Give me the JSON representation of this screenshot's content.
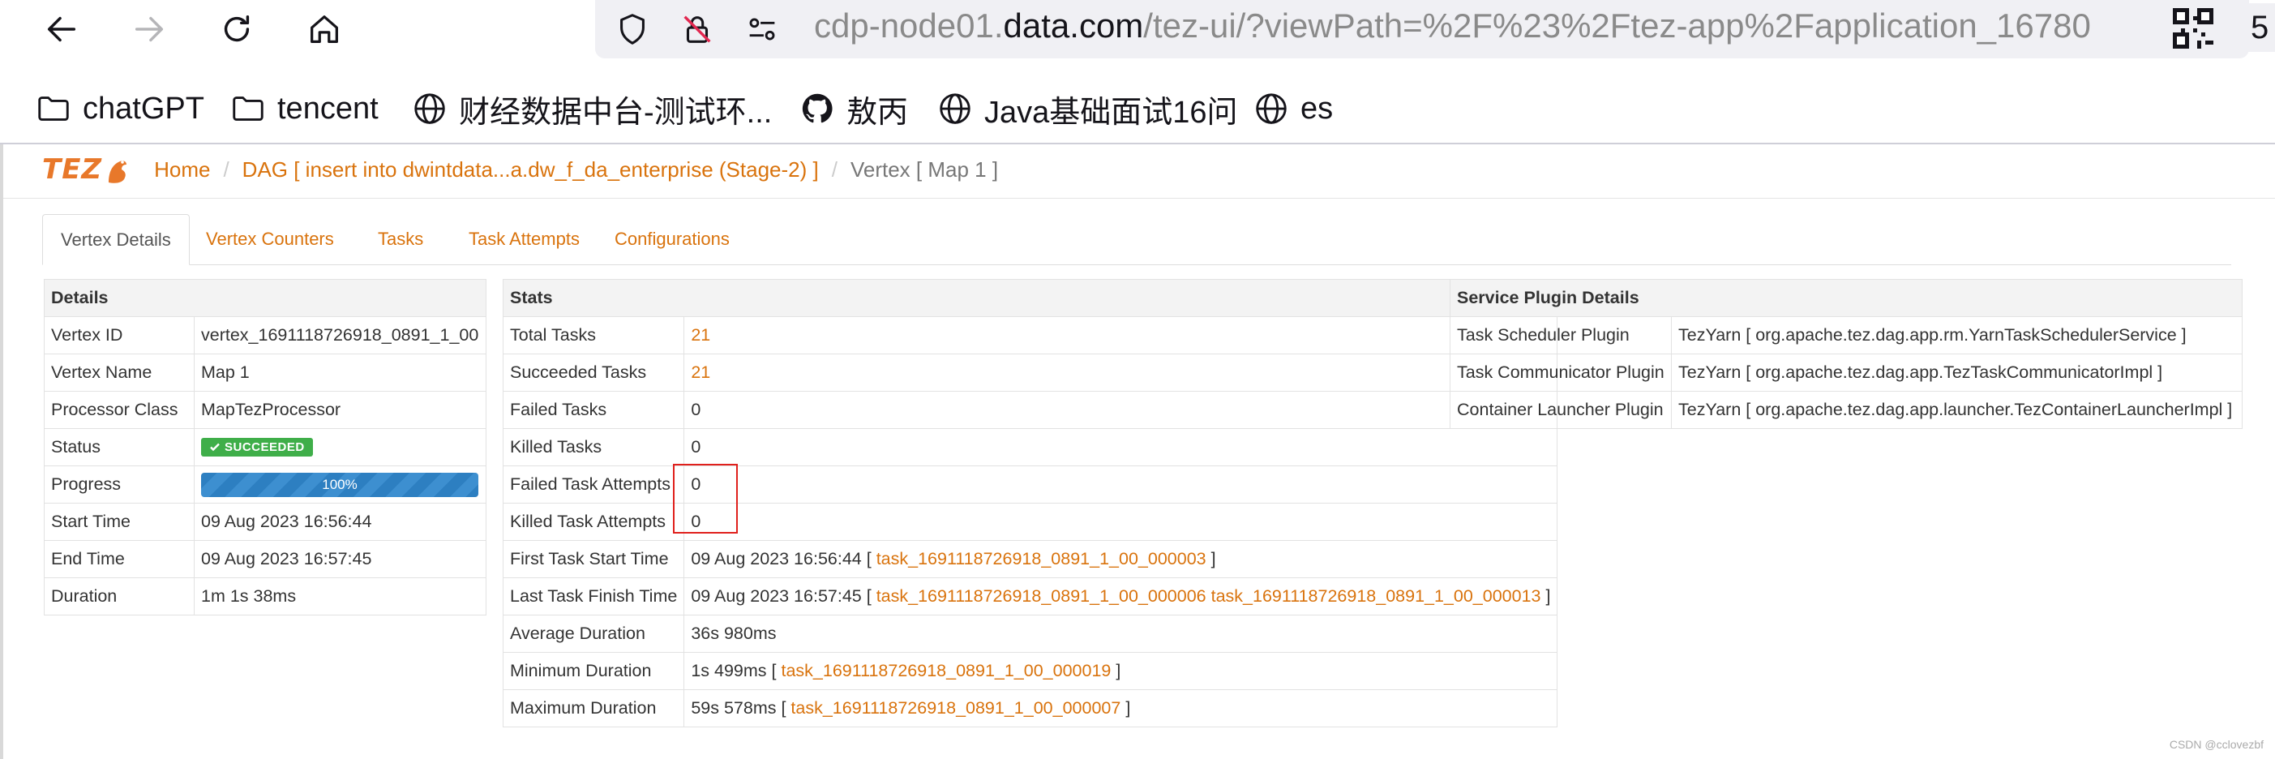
{
  "browser": {
    "url_prefix": "cdp-node01.",
    "url_host": "data.com",
    "url_rest": "/tez-ui/?viewPath=%2F%23%2Ftez-app%2Fapplication_16780",
    "extension_badge": "5"
  },
  "bookmarks": [
    {
      "label": "chatGPT",
      "icon": "folder-icon"
    },
    {
      "label": "tencent",
      "icon": "folder-icon"
    },
    {
      "label": "财经数据中台-测试环...",
      "icon": "globe-icon"
    },
    {
      "label": "敖丙",
      "icon": "github-icon"
    },
    {
      "label": "Java基础面试16问",
      "icon": "globe-icon"
    },
    {
      "label": "es",
      "icon": "globe-icon"
    }
  ],
  "breadcrumb": {
    "logo": "TEZ",
    "home": "Home",
    "dag": "DAG [ insert into dwintdata...a.dw_f_da_enterprise (Stage-2) ]",
    "current": "Vertex [ Map 1 ]"
  },
  "tabs": [
    "Vertex Details",
    "Vertex Counters",
    "Tasks",
    "Task Attempts",
    "Configurations"
  ],
  "details": {
    "header": "Details",
    "vertex_id_label": "Vertex ID",
    "vertex_id": "vertex_1691118726918_0891_1_00",
    "vertex_name_label": "Vertex Name",
    "vertex_name": "Map 1",
    "processor_label": "Processor Class",
    "processor": "MapTezProcessor",
    "status_label": "Status",
    "status": "SUCCEEDED",
    "progress_label": "Progress",
    "progress_text": "100%",
    "progress_value": 1.0,
    "start_label": "Start Time",
    "start": "09 Aug 2023 16:56:44",
    "end_label": "End Time",
    "end": "09 Aug 2023 16:57:45",
    "duration_label": "Duration",
    "duration": "1m 1s 38ms"
  },
  "stats": {
    "header": "Stats",
    "total_label": "Total Tasks",
    "total": "21",
    "succeeded_label": "Succeeded Tasks",
    "succeeded": "21",
    "failed_label": "Failed Tasks",
    "failed": "0",
    "killed_label": "Killed Tasks",
    "killed": "0",
    "failed_attempts_label": "Failed Task Attempts",
    "failed_attempts": "0",
    "killed_attempts_label": "Killed Task Attempts",
    "killed_attempts": "0",
    "first_start_label": "First Task Start Time",
    "first_start_time": "09 Aug 2023 16:56:44",
    "first_start_task": "task_1691118726918_0891_1_00_000003",
    "last_finish_label": "Last Task Finish Time",
    "last_finish_time": "09 Aug 2023 16:57:45",
    "last_finish_task1": "task_1691118726918_0891_1_00_000006",
    "last_finish_task2": "task_1691118726918_0891_1_00_000013",
    "avg_label": "Average Duration",
    "avg": "36s 980ms",
    "min_label": "Minimum Duration",
    "min_time": "1s 499ms",
    "min_task": "task_1691118726918_0891_1_00_000019",
    "max_label": "Maximum Duration",
    "max_time": "59s 578ms",
    "max_task": "task_1691118726918_0891_1_00_000007"
  },
  "plugins": {
    "header": "Service Plugin Details",
    "scheduler_label": "Task Scheduler Plugin",
    "scheduler": "TezYarn [ org.apache.tez.dag.app.rm.YarnTaskSchedulerService ]",
    "communicator_label": "Task Communicator Plugin",
    "communicator": "TezYarn [ org.apache.tez.dag.app.TezTaskCommunicatorImpl ]",
    "launcher_label": "Container Launcher Plugin",
    "launcher": "TezYarn [ org.apache.tez.dag.app.launcher.TezContainerLauncherImpl ]"
  },
  "watermark": "CSDN @cclovezbf"
}
